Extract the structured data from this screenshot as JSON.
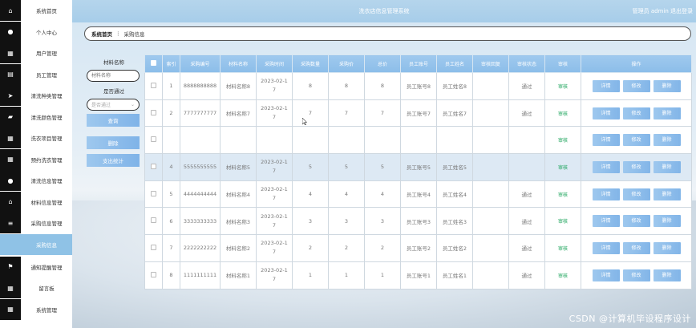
{
  "app_title": "洗衣店信息管理系统",
  "header": {
    "admin_label": "管理员 admin",
    "logout_label": "退出登录"
  },
  "sidebar": {
    "items": [
      {
        "label": "系统首页",
        "icon": "home-icon"
      },
      {
        "label": "个人中心",
        "icon": "user-icon"
      },
      {
        "label": "用户管理",
        "icon": "grid-icon"
      },
      {
        "label": "员工管理",
        "icon": "chart-icon"
      },
      {
        "label": "清洗种类管理",
        "icon": "send-icon"
      },
      {
        "label": "清洗颜色管理",
        "icon": "briefcase-icon"
      },
      {
        "label": "洗衣项目管理",
        "icon": "grid-icon"
      },
      {
        "label": "预约洗衣管理",
        "icon": "grid-icon"
      },
      {
        "label": "清洗信息管理",
        "icon": "user-icon"
      },
      {
        "label": "材料信息管理",
        "icon": "home-icon"
      },
      {
        "label": "采购信息管理",
        "icon": "sliders-icon"
      },
      {
        "label": "采购信息",
        "icon": "",
        "active": true
      },
      {
        "label": "通知提醒管理",
        "icon": "flag-icon"
      },
      {
        "label": "留言板",
        "icon": "grid-icon"
      },
      {
        "label": "系统管理",
        "icon": "grid-icon"
      }
    ]
  },
  "breadcrumb": {
    "home": "系统首页",
    "separator": "⋮",
    "current": "采购信息"
  },
  "search": {
    "material_label": "材料名称",
    "material_placeholder": "材料名称",
    "passed_label": "是否通过",
    "passed_placeholder": "是否通过",
    "query_button": "查询",
    "delete_button": "删除",
    "stats_button": "支出统计"
  },
  "table": {
    "headers": [
      "",
      "索引",
      "采购编号",
      "材料名称",
      "采购时间",
      "采购数量",
      "采购价",
      "总价",
      "员工账号",
      "员工姓名",
      "审核回复",
      "审核状态",
      "审核",
      "操作"
    ],
    "audit_label": "审核",
    "actions": {
      "detail": "详情",
      "edit": "修改",
      "delete": "删除"
    },
    "rows": [
      {
        "index": "1",
        "code": "8888888888",
        "material": "材料名称8",
        "time": "2023-02-17",
        "qty": "8",
        "price": "8",
        "total": "8",
        "account": "员工账号8",
        "name": "员工姓名8",
        "reply": "",
        "status": "通过"
      },
      {
        "index": "2",
        "code": "7777777777",
        "material": "材料名称7",
        "time": "2023-02-17",
        "qty": "7",
        "price": "7",
        "total": "7",
        "account": "员工账号7",
        "name": "员工姓名7",
        "reply": "",
        "status": "通过"
      },
      {
        "index": "",
        "code": "",
        "material": "",
        "time": "",
        "qty": "",
        "price": "",
        "total": "",
        "account": "",
        "name": "",
        "reply": "",
        "status": ""
      },
      {
        "index": "4",
        "code": "5555555555",
        "material": "材料名称5",
        "time": "2023-02-17",
        "qty": "5",
        "price": "5",
        "total": "5",
        "account": "员工账号5",
        "name": "员工姓名5",
        "reply": "",
        "status": ""
      },
      {
        "index": "5",
        "code": "4444444444",
        "material": "材料名称4",
        "time": "2023-02-17",
        "qty": "4",
        "price": "4",
        "total": "4",
        "account": "员工账号4",
        "name": "员工姓名4",
        "reply": "",
        "status": "通过"
      },
      {
        "index": "6",
        "code": "3333333333",
        "material": "材料名称3",
        "time": "2023-02-17",
        "qty": "3",
        "price": "3",
        "total": "3",
        "account": "员工账号3",
        "name": "员工姓名3",
        "reply": "",
        "status": "通过"
      },
      {
        "index": "7",
        "code": "2222222222",
        "material": "材料名称2",
        "time": "2023-02-17",
        "qty": "2",
        "price": "2",
        "total": "2",
        "account": "员工账号2",
        "name": "员工姓名2",
        "reply": "",
        "status": "通过"
      },
      {
        "index": "8",
        "code": "1111111111",
        "material": "材料名称1",
        "time": "2023-02-17",
        "qty": "1",
        "price": "1",
        "total": "1",
        "account": "员工账号1",
        "name": "员工姓名1",
        "reply": "",
        "status": "通过"
      }
    ]
  },
  "watermark": "CSDN @计算机毕设程序设计",
  "colors": {
    "accent": "#8fc2e6",
    "button": "#7fb3e8",
    "audit": "#1aa35a"
  }
}
